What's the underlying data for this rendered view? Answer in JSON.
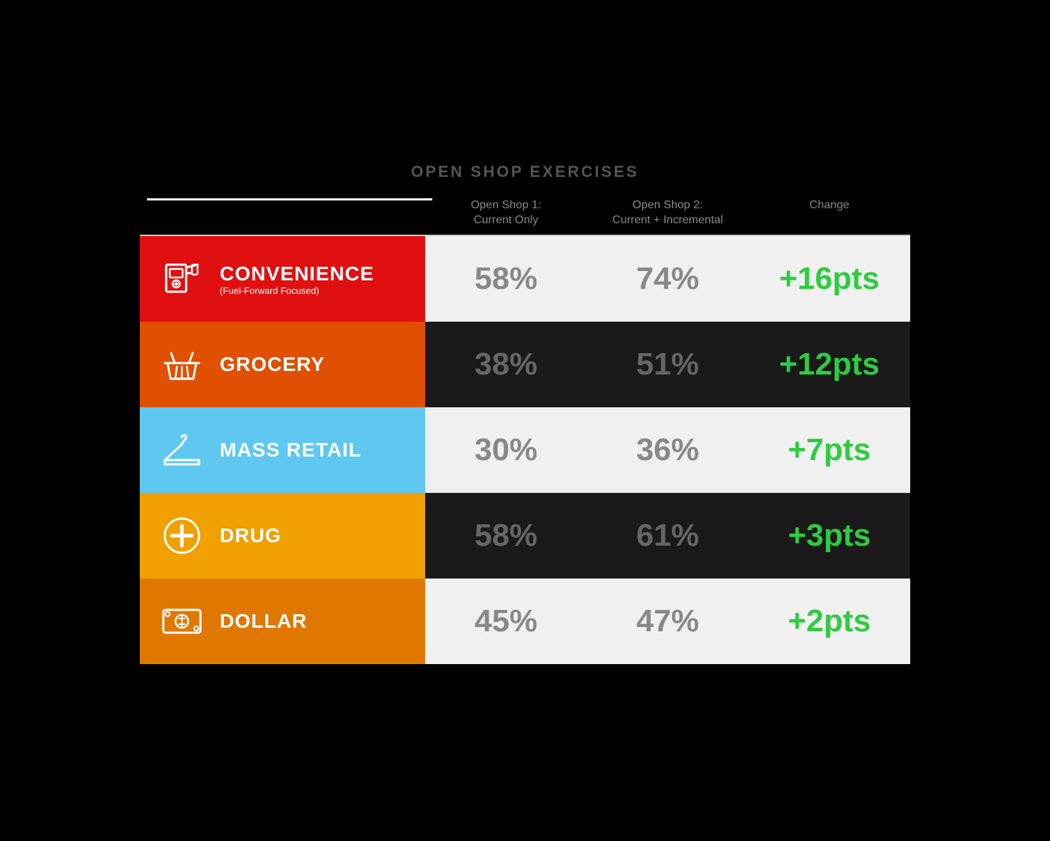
{
  "title": "OPEN SHOP EXERCISES",
  "header": {
    "col1": "",
    "col2_line1": "Open Shop 1:",
    "col2_line2": "Current Only",
    "col3_line1": "Open Shop 2:",
    "col3_line2": "Current + Incremental",
    "col4": "Change"
  },
  "rows": [
    {
      "id": "convenience",
      "name": "CONVENIENCE",
      "subtitle": "(Fuel-Forward Focused)",
      "icon": "fuel",
      "val1": "58%",
      "val2": "74%",
      "change": "+16pts",
      "bgClass": "row-convenience"
    },
    {
      "id": "grocery",
      "name": "GROCERY",
      "subtitle": "",
      "icon": "basket",
      "val1": "38%",
      "val2": "51%",
      "change": "+12pts",
      "bgClass": "row-grocery"
    },
    {
      "id": "massretail",
      "name": "MASS RETAIL",
      "subtitle": "",
      "icon": "hanger",
      "val1": "30%",
      "val2": "36%",
      "change": "+7pts",
      "bgClass": "row-massretail"
    },
    {
      "id": "drug",
      "name": "DRUG",
      "subtitle": "",
      "icon": "cross",
      "val1": "58%",
      "val2": "61%",
      "change": "+3pts",
      "bgClass": "row-drug"
    },
    {
      "id": "dollar",
      "name": "DOLLAR",
      "subtitle": "",
      "icon": "dollar",
      "val1": "45%",
      "val2": "47%",
      "change": "+2pts",
      "bgClass": "row-dollar"
    }
  ]
}
